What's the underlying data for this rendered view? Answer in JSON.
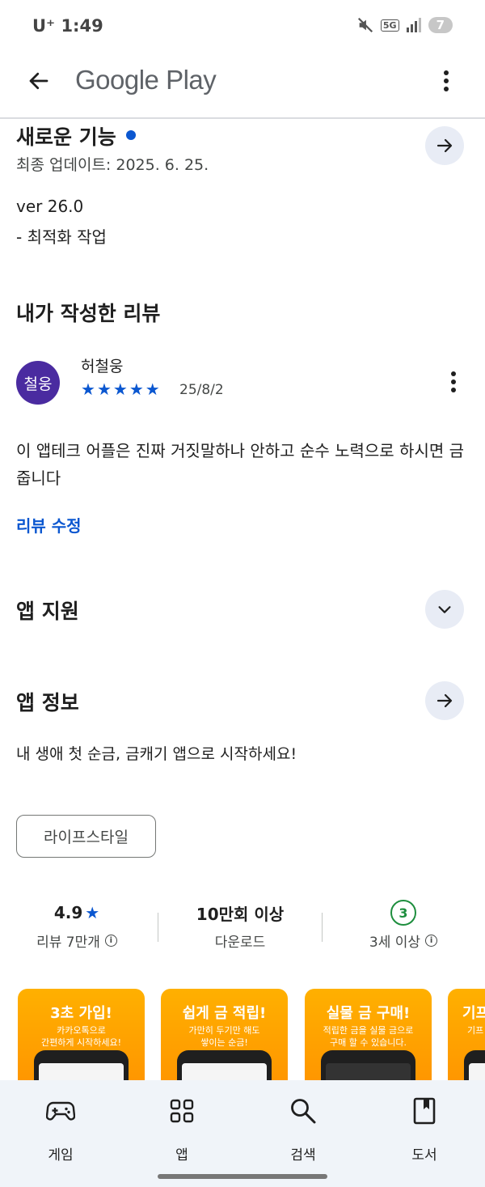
{
  "status_bar": {
    "carrier_time": "U⁺ 1:49",
    "network": "5G",
    "battery": "7"
  },
  "app_bar": {
    "title": "Google Play"
  },
  "whats_new": {
    "title": "새로운 기능",
    "last_updated": "최종 업데이트: 2025. 6. 25.",
    "version": "ver 26.0",
    "note": "- 최적화 작업"
  },
  "my_review": {
    "title": "내가 작성한 리뷰",
    "avatar_text": "철웅",
    "reviewer": "허철웅",
    "rating": 5,
    "date": "25/8/2",
    "text": "이 앱테크 어플은 진짜 거짓말하나 안하고 순수 노력으로 하시면 금 줍니다",
    "edit_label": "리뷰 수정"
  },
  "app_support": {
    "title": "앱 지원"
  },
  "app_info": {
    "title": "앱 정보",
    "description": "내 생애 첫 순금, 금캐기 앱으로 시작하세요!",
    "category_chip": "라이프스타일"
  },
  "stats": {
    "rating": "4.9",
    "rating_label": "리뷰 7만개",
    "downloads": "10만회 이상",
    "downloads_label": "다운로드",
    "age_rating": "3",
    "age_label": "3세 이상"
  },
  "screenshots": [
    {
      "title": "3초 가입!",
      "sub": "카카오톡으로\n간편하게 시작하세요!"
    },
    {
      "title": "쉽게 금 적립!",
      "sub": "가만히 두기만 해도\n쌓이는 순금!"
    },
    {
      "title": "실물 금 구매!",
      "sub": "적립한 금을 실물 금으로\n구매 할 수 있습니다."
    },
    {
      "title": "기프",
      "sub": "기프"
    }
  ],
  "bottom_nav": [
    {
      "label": "게임",
      "icon": "gamepad-icon"
    },
    {
      "label": "앱",
      "icon": "apps-grid-icon"
    },
    {
      "label": "검색",
      "icon": "search-icon"
    },
    {
      "label": "도서",
      "icon": "book-icon"
    }
  ],
  "colors": {
    "accent": "#0b57d0",
    "star": "#0b57d0",
    "avatar": "#4a2ba0",
    "age_badge": "#1e8e3e",
    "screenshot_bg": "#ffa000"
  }
}
